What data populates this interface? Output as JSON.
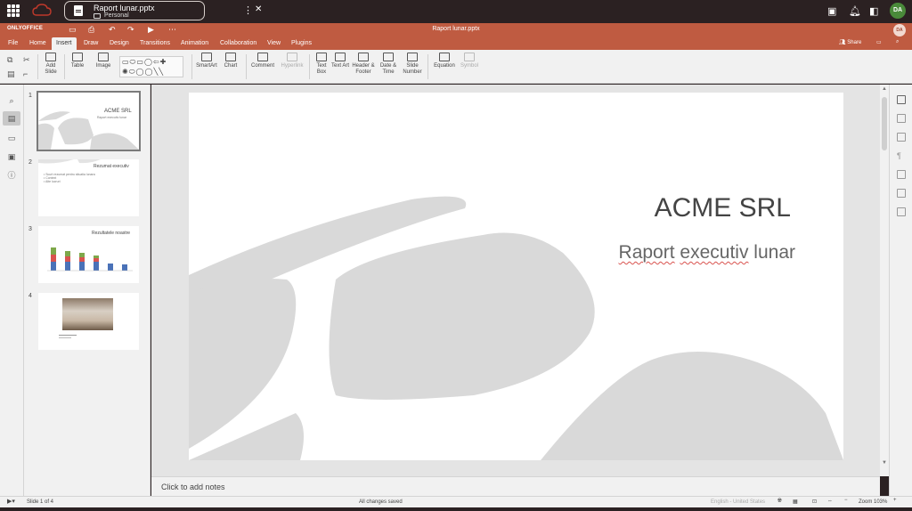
{
  "topbar": {
    "tab_title": "Raport lunar.pptx",
    "tab_location": "Personal",
    "avatar": "DA"
  },
  "header": {
    "brand": "ONLYOFFICE",
    "doc_title": "Raport lunar.pptx",
    "avatar": "DA",
    "share_label": "Share"
  },
  "menu": {
    "tabs": [
      "File",
      "Home",
      "Insert",
      "Draw",
      "Design",
      "Transitions",
      "Animation",
      "Collaboration",
      "View",
      "Plugins"
    ],
    "active": "Insert"
  },
  "toolbar": {
    "add_slide": "Add Slide",
    "table": "Table",
    "image": "Image",
    "smartart": "SmartArt",
    "chart": "Chart",
    "comment": "Comment",
    "hyperlink": "Hyperlink",
    "text_box": "Text Box",
    "text_art": "Text Art",
    "header_footer": "Header & Footer",
    "date_time": "Date & Time",
    "slide_number": "Slide Number",
    "equation": "Equation",
    "symbol": "Symbol"
  },
  "thumbnails": [
    {
      "num": "1",
      "title": "ACME SRL",
      "sub": "Raport executiv lunar"
    },
    {
      "num": "2",
      "title": "Rezumat executiv",
      "bullets": [
        "Scurt rezumat pentru situatia lunara",
        "Context",
        "Alte lucruri"
      ]
    },
    {
      "num": "3",
      "title": "Rezultatele noastre"
    },
    {
      "num": "4",
      "title": ""
    }
  ],
  "slide": {
    "title": "ACME SRL",
    "subtitle_words": [
      "Raport",
      "executiv",
      "lunar"
    ]
  },
  "notes": {
    "placeholder": "Click to add notes"
  },
  "status": {
    "slide_counter": "Slide 1 of 4",
    "saved": "All changes saved",
    "language": "English - United States",
    "zoom": "Zoom 103%"
  },
  "colors": {
    "accent": "#bf5b41",
    "topbar": "#2b2122",
    "shape_fill": "#d9d9d9"
  }
}
